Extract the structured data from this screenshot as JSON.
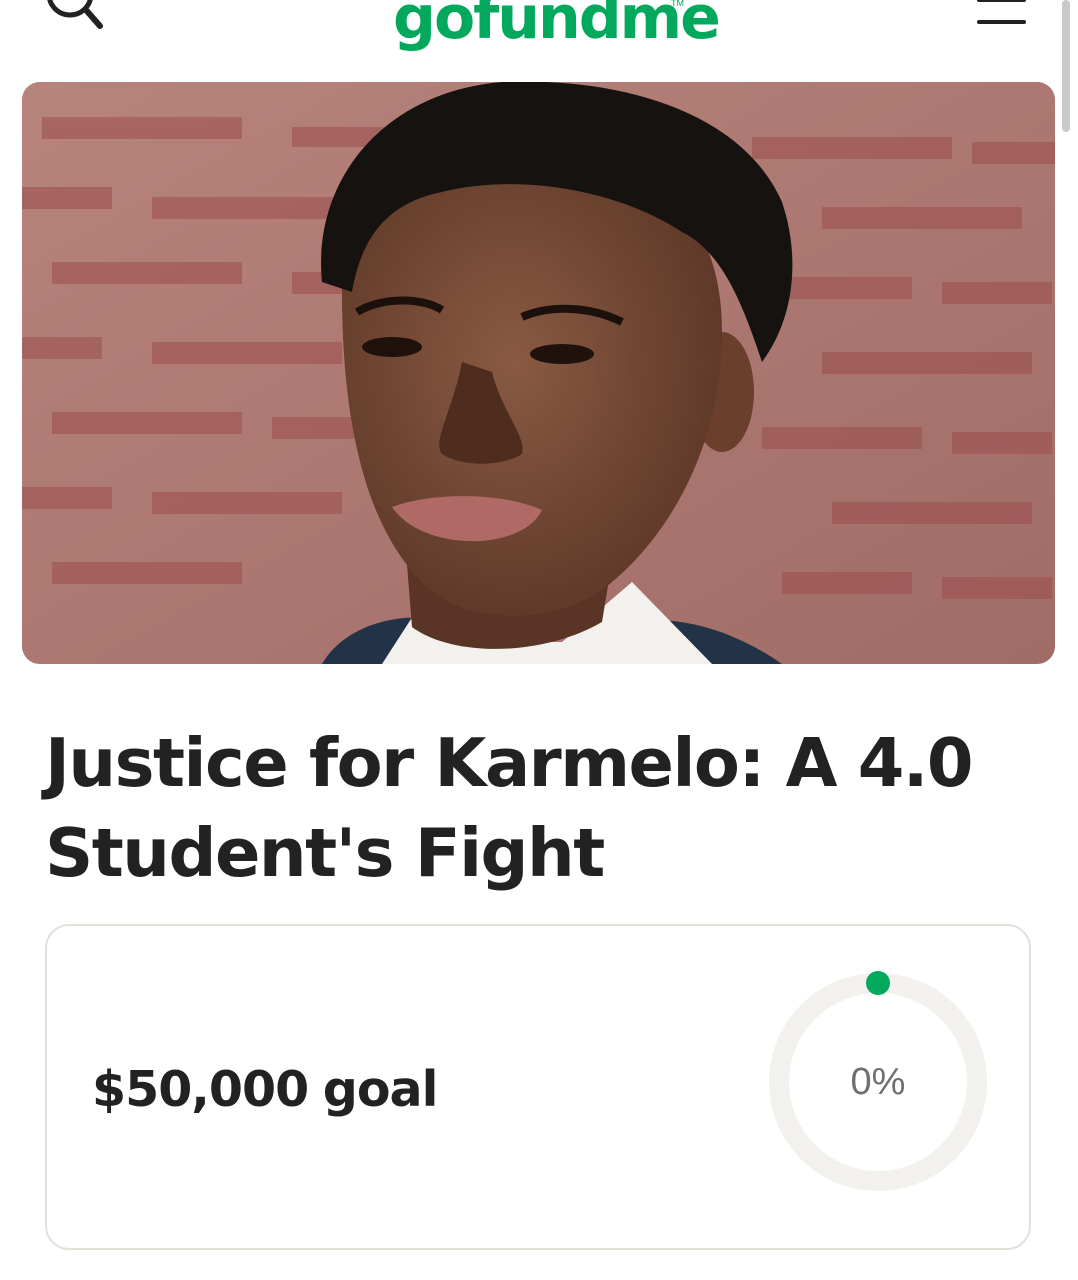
{
  "header": {
    "logo": "gofundme",
    "logo_tm": "TM",
    "search_icon": "search-icon",
    "menu_icon": "hamburger-menu-icon"
  },
  "hero": {
    "image": "campaign-photo"
  },
  "campaign": {
    "title": "Justice for Karmelo: A 4.0 Student's Fight"
  },
  "goal": {
    "amount": "$50,000",
    "label": "goal",
    "progress_text": "0%",
    "progress_fraction": 0
  },
  "colors": {
    "brand": "#02a95c",
    "text": "#222222",
    "ring_track": "#f2f1ed",
    "card_border": "#e4e1da"
  }
}
